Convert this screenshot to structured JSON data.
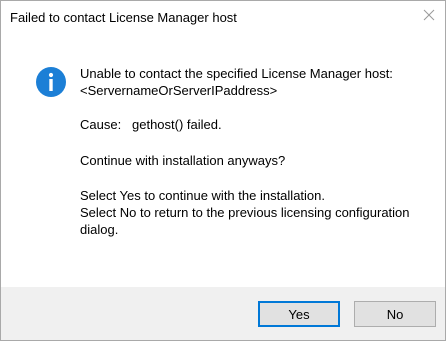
{
  "window": {
    "title": "Failed to contact License Manager host"
  },
  "message": {
    "line1": "Unable to contact the specified License Manager host:",
    "line2": "<ServernameOrServerIPaddress>",
    "cause_label": "Cause:",
    "cause_value": "gethost() failed.",
    "question": "Continue with installation anyways?",
    "yes_hint": "Select Yes to continue with the installation.",
    "no_hint": "Select No to return to the previous licensing configuration dialog."
  },
  "buttons": {
    "yes_label": "Yes",
    "no_label": "No"
  },
  "icons": {
    "dialog_icon": "info-icon",
    "close_icon": "close-icon"
  },
  "colors": {
    "info_blue": "#1c7fd6",
    "focus_border": "#0078d7",
    "footer_bg": "#f0f0f0",
    "button_bg": "#e1e1e1"
  }
}
